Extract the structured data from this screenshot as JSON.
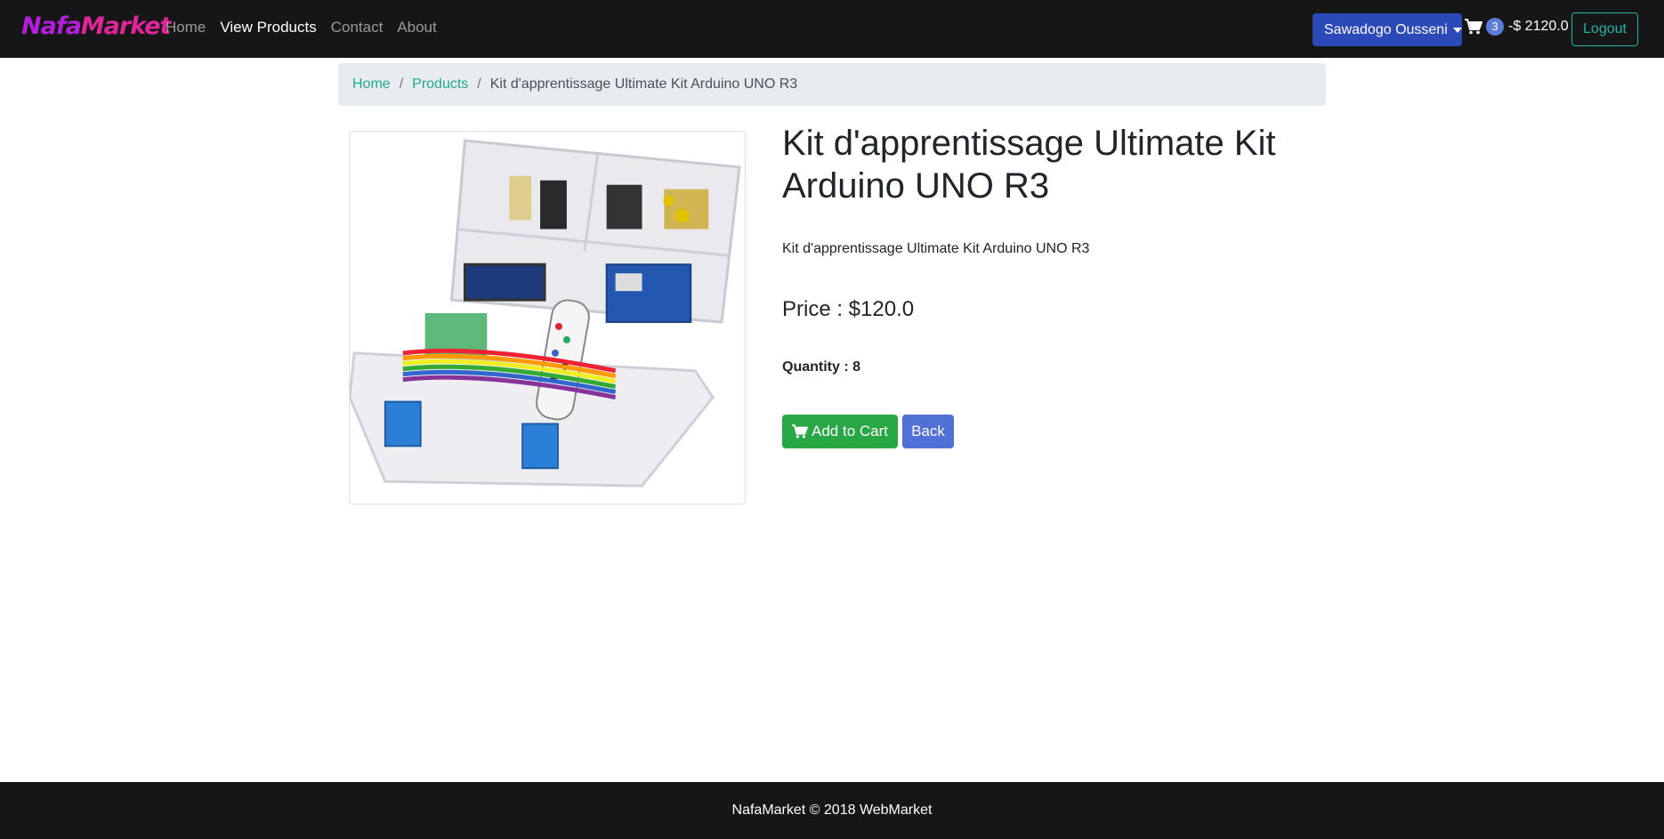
{
  "navbar": {
    "brand_prefix": "Nafa",
    "brand_suffix": "Market",
    "links": [
      {
        "label": "Home"
      },
      {
        "label": "View Products"
      },
      {
        "label": "Contact"
      },
      {
        "label": "About"
      }
    ],
    "user_menu": "Sawadogo Ousseni",
    "cart_count": "3",
    "cart_total": "-$ 2120.0",
    "logout": "Logout"
  },
  "breadcrumb": {
    "home": "Home",
    "products": "Products",
    "separator": "/",
    "current": "Kit d'apprentissage Ultimate Kit Arduino UNO R3"
  },
  "product": {
    "title": "Kit d'apprentissage Ultimate Kit Arduino UNO R3",
    "description": "Kit d'apprentissage Ultimate Kit Arduino UNO R3",
    "price_label": "Price : $120.0",
    "quantity_label": "Quantity : 8",
    "add_to_cart": "Add to Cart",
    "back": "Back"
  },
  "footer": {
    "text": "NafaMarket © 2018 WebMarket"
  },
  "colors": {
    "navbar_bg": "#161616",
    "user_button": "#2c49b9",
    "logout_outline": "#1fb4a3",
    "breadcrumb_bg": "#e9ecef",
    "link_teal": "#20a896",
    "add_to_cart_green": "#28a745",
    "back_blue": "#5170d6"
  }
}
